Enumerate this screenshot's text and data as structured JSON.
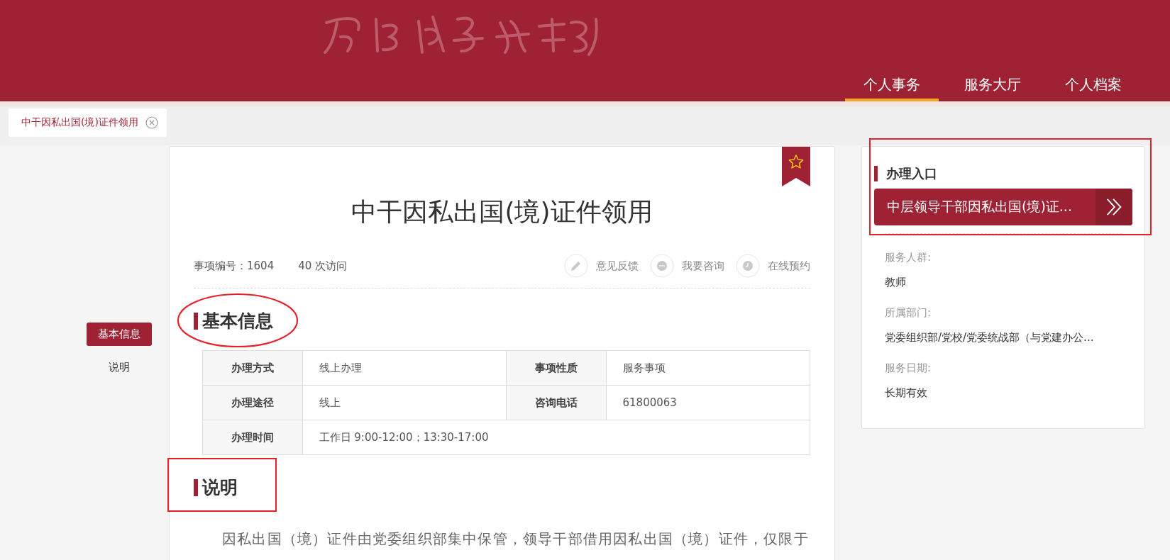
{
  "header": {
    "nav": [
      {
        "label": "个人事务",
        "selected": true
      },
      {
        "label": "服务大厅",
        "selected": false
      },
      {
        "label": "个人档案",
        "selected": false
      }
    ]
  },
  "open_tabs": [
    {
      "label": "中干因私出国(境)证件领用",
      "selected": true
    }
  ],
  "side_nav": [
    {
      "label": "基本信息",
      "selected": true
    },
    {
      "label": "说明",
      "selected": false
    }
  ],
  "item": {
    "title": "中干因私出国(境)证件领用",
    "number": "事项编号：1604",
    "visits": "40 次访问",
    "actions": [
      {
        "kind": "edit",
        "label": "意见反馈"
      },
      {
        "kind": "chat",
        "label": "我要咨询"
      },
      {
        "kind": "clock",
        "label": "在线预约"
      }
    ],
    "sections": [
      {
        "kind": "table",
        "heading": "基本信息",
        "circled": true,
        "boxed": false,
        "rows": [
          [
            {
              "label": "办理方式",
              "value": "线上办理"
            },
            {
              "label": "事项性质",
              "value": "服务事项"
            }
          ],
          [
            {
              "label": "办理途径",
              "value": "线上"
            },
            {
              "label": "咨询电话",
              "value": "61800063"
            }
          ],
          [
            {
              "label": "办理时间",
              "value": "工作日 9:00-12:00；13:30-17:00"
            }
          ]
        ]
      },
      {
        "kind": "text",
        "heading": "说明",
        "circled": false,
        "boxed": true,
        "paragraphs": [
          "因私出国（境）证件由党委组织部集中保管，领导干部借用因私出国（境）证件，仅限于"
        ]
      }
    ]
  },
  "side_panel": {
    "entry": {
      "heading": "办理入口",
      "button": "中层领导干部因私出国(境)证...",
      "boxed": true
    },
    "facts": [
      {
        "label": "服务人群:",
        "value": "教师"
      },
      {
        "label": "所属部门:",
        "value": "党委组织部/党校/党委统战部（与党建办公..."
      },
      {
        "label": "服务日期:",
        "value": "长期有效"
      }
    ]
  }
}
